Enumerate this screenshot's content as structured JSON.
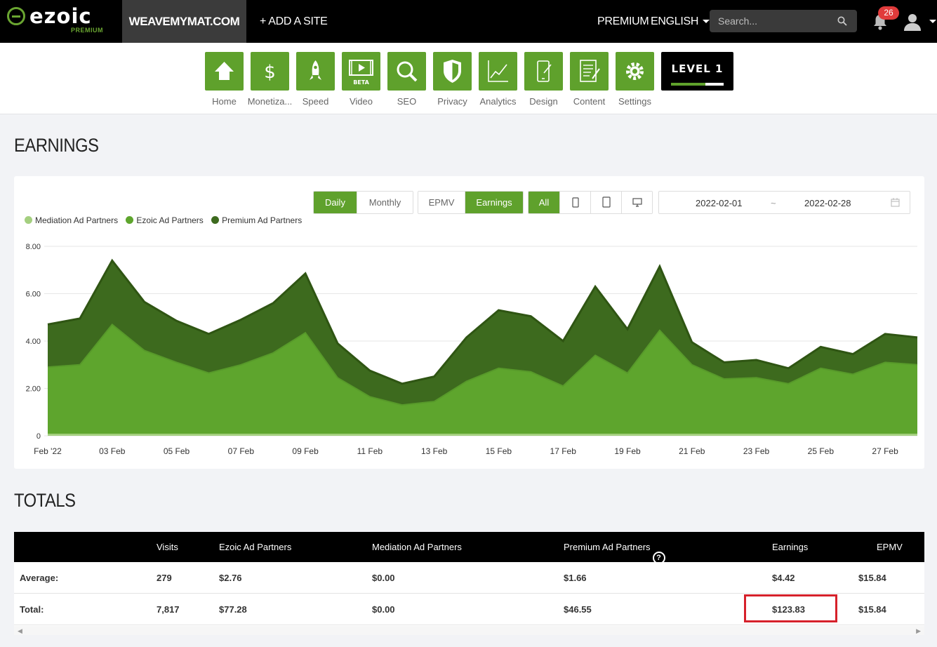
{
  "topbar": {
    "logo_text": "ezoic",
    "logo_sub": "PREMIUM",
    "site": "WEAVEMYMAT.COM",
    "add_site": "+ ADD A SITE",
    "premium": "PREMIUM",
    "language": "ENGLISH",
    "search_placeholder": "Search...",
    "notification_count": "26"
  },
  "toolbar": {
    "tools": [
      {
        "label": "Home",
        "icon": "home-icon"
      },
      {
        "label": "Monetiza...",
        "icon": "dollar-icon"
      },
      {
        "label": "Speed",
        "icon": "rocket-icon"
      },
      {
        "label": "Video",
        "icon": "video-icon",
        "badge": "BETA"
      },
      {
        "label": "SEO",
        "icon": "magnifier-icon"
      },
      {
        "label": "Privacy",
        "icon": "shield-icon"
      },
      {
        "label": "Analytics",
        "icon": "line-chart-icon"
      },
      {
        "label": "Design",
        "icon": "design-icon"
      },
      {
        "label": "Content",
        "icon": "document-icon"
      },
      {
        "label": "Settings",
        "icon": "gear-icon"
      }
    ],
    "level_label": "LEVEL 1",
    "level_progress": 0.65
  },
  "earnings": {
    "title": "EARNINGS",
    "period_buttons": [
      "Daily",
      "Monthly"
    ],
    "metric_buttons": [
      "EPMV",
      "Earnings"
    ],
    "device_all": "All",
    "date_start": "2022-02-01",
    "date_sep": "~",
    "date_end": "2022-02-28"
  },
  "colors": {
    "accent": "#5fa12c",
    "mediation": "#a4cf7f",
    "ezoic": "#5ea52d",
    "premium": "#3d6a1e",
    "premium_line": "#2f5513"
  },
  "chart_data": {
    "type": "area",
    "stacked": true,
    "x": [
      "Feb '22",
      "02 Feb",
      "03 Feb",
      "04 Feb",
      "05 Feb",
      "06 Feb",
      "07 Feb",
      "08 Feb",
      "09 Feb",
      "10 Feb",
      "11 Feb",
      "12 Feb",
      "13 Feb",
      "14 Feb",
      "15 Feb",
      "16 Feb",
      "17 Feb",
      "18 Feb",
      "19 Feb",
      "20 Feb",
      "21 Feb",
      "22 Feb",
      "23 Feb",
      "24 Feb",
      "25 Feb",
      "26 Feb",
      "27 Feb",
      "28 Feb"
    ],
    "tick_labels": [
      "Feb '22",
      "03 Feb",
      "05 Feb",
      "07 Feb",
      "09 Feb",
      "11 Feb",
      "13 Feb",
      "15 Feb",
      "17 Feb",
      "19 Feb",
      "21 Feb",
      "23 Feb",
      "25 Feb",
      "27 Feb"
    ],
    "series": [
      {
        "name": "Mediation Ad Partners",
        "values": [
          0,
          0,
          0,
          0,
          0,
          0,
          0,
          0,
          0,
          0,
          0,
          0,
          0,
          0,
          0,
          0,
          0,
          0,
          0,
          0,
          0,
          0,
          0,
          0,
          0,
          0,
          0,
          0
        ]
      },
      {
        "name": "Ezoic Ad Partners",
        "values": [
          2.9,
          3.0,
          4.7,
          3.6,
          3.1,
          2.65,
          3.0,
          3.5,
          4.35,
          2.45,
          1.65,
          1.3,
          1.45,
          2.3,
          2.85,
          2.7,
          2.1,
          3.4,
          2.65,
          4.45,
          3.0,
          2.4,
          2.45,
          2.2,
          2.85,
          2.6,
          3.1,
          3.0
        ]
      },
      {
        "name": "Premium Ad Partners",
        "values": [
          1.8,
          1.95,
          2.7,
          2.05,
          1.75,
          1.65,
          1.9,
          2.1,
          2.5,
          1.45,
          1.1,
          0.9,
          1.05,
          1.85,
          2.45,
          2.35,
          1.9,
          2.9,
          1.85,
          2.7,
          0.95,
          0.7,
          0.75,
          0.65,
          0.9,
          0.85,
          1.2,
          1.15
        ]
      }
    ],
    "yticks": [
      "0",
      "2.00",
      "4.00",
      "6.00",
      "8.00"
    ],
    "ylim": [
      0,
      8
    ],
    "grid": true,
    "legend_position": "top-left"
  },
  "totals": {
    "title": "TOTALS",
    "headers": [
      "Visits",
      "Ezoic Ad Partners",
      "Mediation Ad Partners",
      "Premium Ad Partners",
      "Earnings",
      "EPMV"
    ],
    "rows": [
      {
        "label": "Average:",
        "values": [
          "279",
          "$2.76",
          "$0.00",
          "$1.66",
          "$4.42",
          "$15.84"
        ]
      },
      {
        "label": "Total:",
        "values": [
          "7,817",
          "$77.28",
          "$0.00",
          "$46.55",
          "$123.83",
          "$15.84"
        ]
      }
    ]
  }
}
